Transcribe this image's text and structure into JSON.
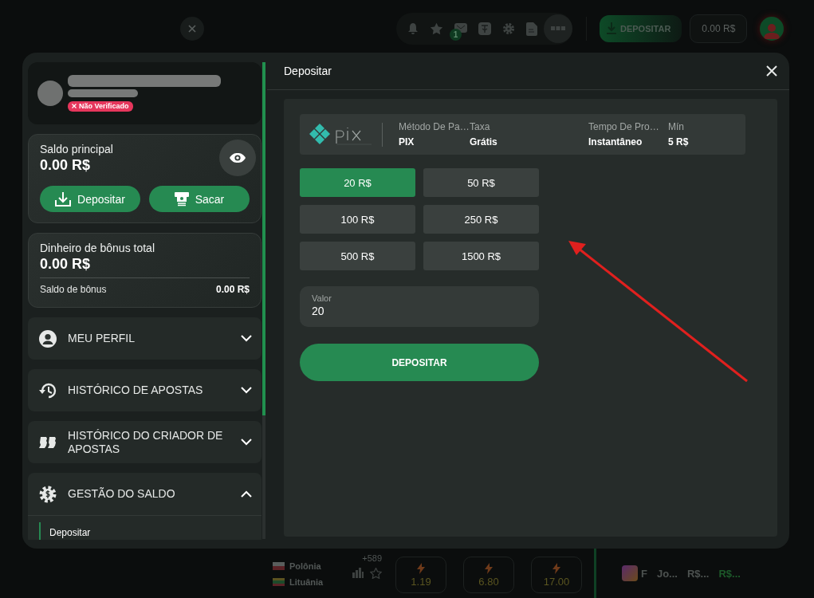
{
  "topbar": {
    "notification_count": "1",
    "deposit_button": "DEPOSITAR",
    "balance": "0.00 R$"
  },
  "modal": {
    "title": "Depositar",
    "profile": {
      "badge": "Não Verificado"
    },
    "main_balance": {
      "label": "Saldo principal",
      "amount": "0.00 R$",
      "buttons": [
        {
          "label": "Depositar",
          "kind": "deposit"
        },
        {
          "label": "Sacar",
          "kind": "withdraw"
        }
      ]
    },
    "bonus": {
      "label": "Dinheiro de bônus total",
      "amount": "0.00 R$",
      "sub_label": "Saldo de bônus",
      "sub_amount": "0.00 R$"
    },
    "menu": [
      {
        "label": "MEU PERFIL",
        "kind": "profile",
        "expanded": false
      },
      {
        "label": "HISTÓRICO DE APOSTAS",
        "kind": "history",
        "expanded": false
      },
      {
        "label": "HISTÓRICO DO CRIADOR DE APOSTAS",
        "kind": "builder",
        "expanded": false
      },
      {
        "label": "GESTÃO DO SALDO",
        "kind": "balance",
        "expanded": true,
        "children": [
          {
            "label": "Depositar",
            "selected": true
          }
        ]
      }
    ],
    "payment_method": {
      "columns": [
        {
          "header": "Método De Pa…",
          "value": "PIX"
        },
        {
          "header": "Taxa",
          "value": "Grátis"
        },
        {
          "header": "Tempo De Pro…",
          "value": "Instantâneo"
        },
        {
          "header": "Mín",
          "value": "5 R$"
        }
      ]
    },
    "amounts": [
      {
        "label": "20 R$",
        "selected": true
      },
      {
        "label": "50 R$",
        "selected": false
      },
      {
        "label": "100 R$",
        "selected": false
      },
      {
        "label": "250 R$",
        "selected": false
      },
      {
        "label": "500 R$",
        "selected": false
      },
      {
        "label": "1500 R$",
        "selected": false
      }
    ],
    "amount_field": {
      "label": "Valor",
      "value": "20"
    },
    "submit": "DEPOSITAR"
  },
  "background": {
    "teams": [
      "Polônia",
      "Lituânia"
    ],
    "markets_count": "+589",
    "odds": [
      "1.19",
      "6.80",
      "17.00"
    ],
    "bet_row": [
      {
        "text": "F",
        "highlight": false
      },
      {
        "text": "Jo...",
        "highlight": false
      },
      {
        "text": "R$...",
        "highlight": false
      },
      {
        "text": "R$...",
        "highlight": true
      }
    ]
  }
}
